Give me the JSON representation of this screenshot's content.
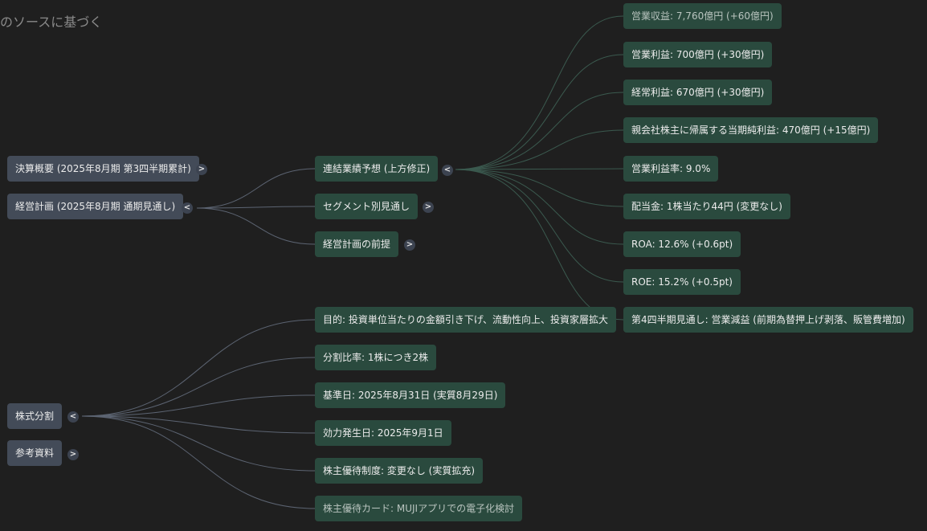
{
  "header": {
    "title": "のソースに基づく"
  },
  "toggles": {
    "expanded": "<",
    "collapsed": ">"
  },
  "colors": {
    "background": "#1f1f1f",
    "level1_node": "#434b58",
    "level2_node": "#2a4a3e",
    "link_level1": "#5c6472",
    "link_level2": "#3b5a4f"
  },
  "mindmap": {
    "level1": [
      {
        "label": "決算概要 (2025年8月期 第3四半期累計)",
        "state": "collapsed"
      },
      {
        "label": "経営計画 (2025年8月期 通期見通し)",
        "state": "expanded"
      },
      {
        "label": "株式分割",
        "state": "expanded"
      },
      {
        "label": "参考資料",
        "state": "collapsed"
      }
    ],
    "plan_children": [
      {
        "label": "連結業績予想 (上方修正)",
        "state": "expanded"
      },
      {
        "label": "セグメント別見通し",
        "state": "collapsed"
      },
      {
        "label": "経営計画の前提",
        "state": "collapsed"
      }
    ],
    "forecast_children": [
      {
        "label": "営業収益: 7,760億円 (+60億円)"
      },
      {
        "label": "営業利益: 700億円 (+30億円)"
      },
      {
        "label": "経常利益: 670億円 (+30億円)"
      },
      {
        "label": "親会社株主に帰属する当期純利益: 470億円 (+15億円)"
      },
      {
        "label": "営業利益率: 9.0%"
      },
      {
        "label": "配当金: 1株当たり44円 (変更なし)"
      },
      {
        "label": "ROA: 12.6% (+0.6pt)"
      },
      {
        "label": "ROE: 15.2% (+0.5pt)"
      },
      {
        "label": "第4四半期見通し: 営業減益 (前期為替押上げ剥落、販管費増加)"
      }
    ],
    "split_children": [
      {
        "label": "目的: 投資単位当たりの金額引き下げ、流動性向上、投資家層拡大"
      },
      {
        "label": "分割比率: 1株につき2株"
      },
      {
        "label": "基準日: 2025年8月31日 (実質8月29日)"
      },
      {
        "label": "効力発生日: 2025年9月1日"
      },
      {
        "label": "株主優待制度: 変更なし (実質拡充)"
      },
      {
        "label": "株主優待カード: MUJIアプリでの電子化検討"
      }
    ]
  }
}
